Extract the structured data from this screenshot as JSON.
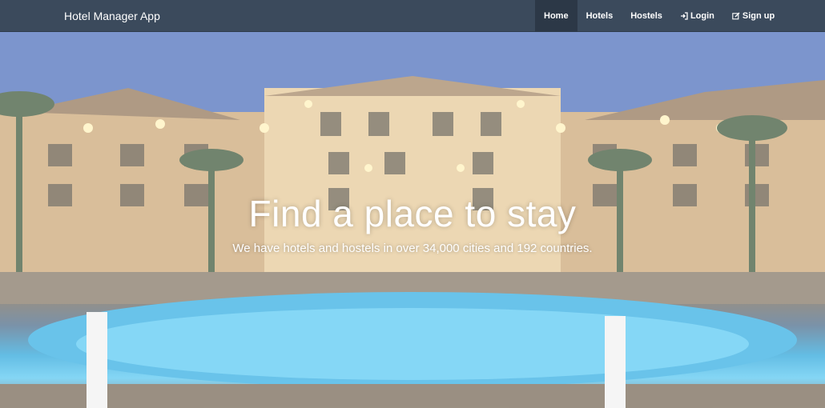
{
  "navbar": {
    "brand": "Hotel Manager App",
    "items": [
      {
        "label": "Home",
        "icon": "",
        "active": true
      },
      {
        "label": "Hotels",
        "icon": "",
        "active": false
      },
      {
        "label": "Hostels",
        "icon": "",
        "active": false
      },
      {
        "label": "Login",
        "icon": "login-icon",
        "active": false
      },
      {
        "label": "Sign up",
        "icon": "edit-icon",
        "active": false
      }
    ]
  },
  "hero": {
    "title": "Find a place to stay",
    "subtitle": "We have hotels and hostels in over 34,000 cities and 192 countries."
  },
  "colors": {
    "navbar_bg": "#3b4a5c",
    "navbar_active_bg": "#2c3847",
    "text": "#ffffff"
  }
}
